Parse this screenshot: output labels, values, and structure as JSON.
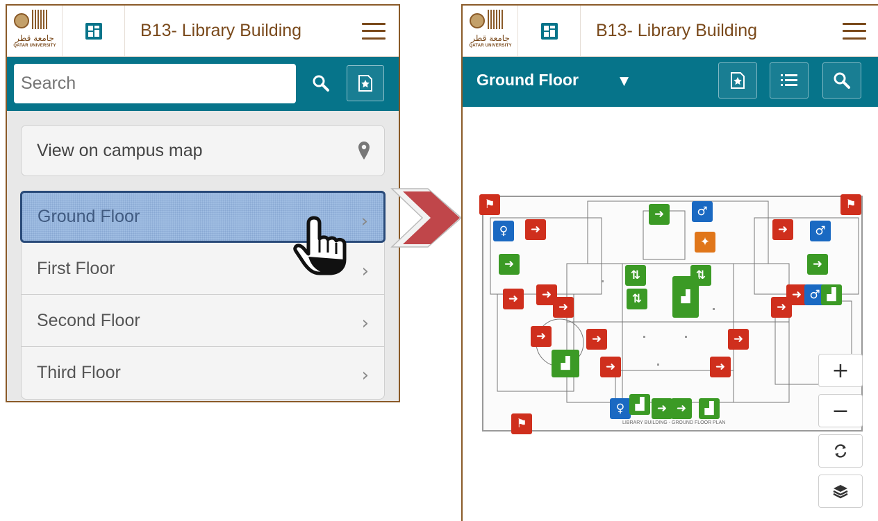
{
  "header": {
    "building_title": "B13- Library Building",
    "logo_arabic": "جامعة قطر",
    "logo_english": "QATAR UNIVERSITY"
  },
  "left_screen": {
    "search": {
      "placeholder": "Search",
      "value": ""
    },
    "campus_map_label": "View on campus map",
    "floors": [
      {
        "label": "Ground Floor",
        "selected": true
      },
      {
        "label": "First Floor",
        "selected": false
      },
      {
        "label": "Second Floor",
        "selected": false
      },
      {
        "label": "Third Floor",
        "selected": false
      }
    ]
  },
  "right_screen": {
    "current_floor": "Ground Floor",
    "plan_caption": "LIBRARY BUILDING - GROUND FLOOR PLAN",
    "zoom_in": "+",
    "zoom_out": "−"
  },
  "colors": {
    "brand_brown": "#7a4a1c",
    "toolbar_teal": "#06748a",
    "selection_blue": "#9fbde2",
    "exit_red": "#cf2f1d",
    "stairs_green": "#3b9a25",
    "restroom_blue": "#1a69c2",
    "arrow_red": "#c0464a"
  },
  "icons": [
    "map-icon",
    "menu-icon",
    "search-icon",
    "bookmark-star-icon",
    "location-pin-icon",
    "chevron-right-icon",
    "hand-pointer-icon",
    "list-icon",
    "refresh-icon",
    "layers-icon"
  ]
}
